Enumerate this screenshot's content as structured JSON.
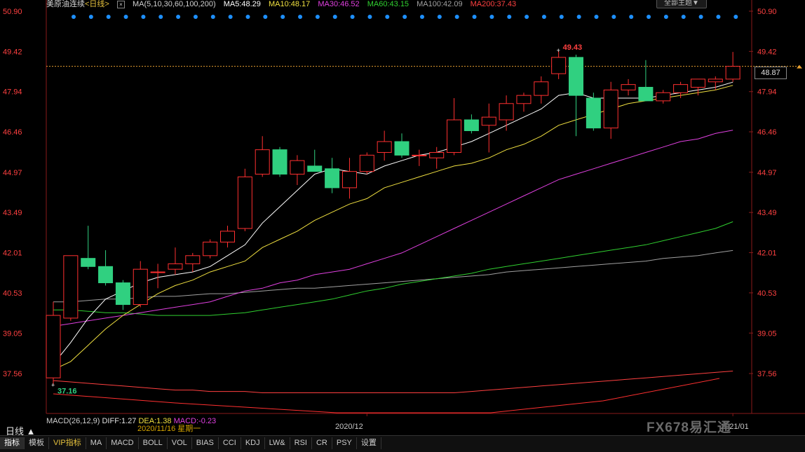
{
  "header": {
    "symbol": "美原油连续",
    "period": "<日线>",
    "ma_title": "MA(5,10,30,60,100,200)",
    "ma_values": [
      {
        "label": "MA5:48.29",
        "color": "#ffffff"
      },
      {
        "label": "MA10:48.17",
        "color": "#f0e040"
      },
      {
        "label": "MA30:46.52",
        "color": "#e040e0"
      },
      {
        "label": "MA60:43.15",
        "color": "#30d030"
      },
      {
        "label": "MA100:42.09",
        "color": "#a0a0a0"
      },
      {
        "label": "MA200:37.43",
        "color": "#ff4040"
      }
    ],
    "theme_button": "全部主题▼"
  },
  "last_price": "48.87",
  "price_axis_labels": [
    "50.90",
    "49.42",
    "47.94",
    "46.46",
    "44.97",
    "43.49",
    "42.01",
    "40.53",
    "39.05",
    "37.56"
  ],
  "high_label": "49.43",
  "low_label": "37.16",
  "bottom": {
    "period_label": "日线 ▲",
    "macd_title": "MACD(26,12,9)",
    "diff": "DIFF:1.27",
    "dea": "DEA:1.38",
    "macd": "MACD:-0.23",
    "cursor_date": "2020/11/16 星期一",
    "date_ticks": [
      {
        "label": "2020/12",
        "idx": 18
      },
      {
        "label": "2021/01",
        "idx": 39
      }
    ],
    "watermark": "FX678易汇通"
  },
  "toolbar": {
    "tabs": [
      "指标",
      "模板",
      "VIP指标",
      "MA",
      "MACD",
      "BOLL",
      "VOL",
      "BIAS",
      "CCI",
      "KDJ",
      "LW&",
      "RSI",
      "CR",
      "PSY",
      "设置"
    ]
  },
  "colors": {
    "up": "#ff3030",
    "down": "#30d080",
    "ma5": "#ffffff",
    "ma10": "#f0e040",
    "ma30": "#e040e0",
    "ma60": "#30d030",
    "ma100": "#a0a0a0",
    "ma200": "#ff4040"
  },
  "chart_data": {
    "type": "candlestick",
    "ylim": [
      37.0,
      51.0
    ],
    "candles": [
      {
        "o": 37.4,
        "h": 40.2,
        "l": 37.16,
        "c": 39.7
      },
      {
        "o": 39.6,
        "h": 40.0,
        "l": 39.5,
        "c": 41.9
      },
      {
        "o": 41.8,
        "h": 43.0,
        "l": 41.4,
        "c": 41.5
      },
      {
        "o": 41.5,
        "h": 42.1,
        "l": 40.8,
        "c": 40.9
      },
      {
        "o": 40.9,
        "h": 41.0,
        "l": 39.9,
        "c": 40.1
      },
      {
        "o": 40.1,
        "h": 41.7,
        "l": 40.0,
        "c": 41.4
      },
      {
        "o": 41.3,
        "h": 41.6,
        "l": 40.7,
        "c": 41.3
      },
      {
        "o": 41.4,
        "h": 42.2,
        "l": 41.2,
        "c": 41.6
      },
      {
        "o": 41.6,
        "h": 42.0,
        "l": 41.3,
        "c": 41.9
      },
      {
        "o": 41.9,
        "h": 42.5,
        "l": 41.8,
        "c": 42.4
      },
      {
        "o": 42.4,
        "h": 43.0,
        "l": 42.2,
        "c": 42.8
      },
      {
        "o": 42.9,
        "h": 45.1,
        "l": 42.8,
        "c": 44.8
      },
      {
        "o": 44.9,
        "h": 46.3,
        "l": 44.8,
        "c": 45.8
      },
      {
        "o": 45.8,
        "h": 45.9,
        "l": 44.8,
        "c": 44.9
      },
      {
        "o": 44.9,
        "h": 45.6,
        "l": 44.5,
        "c": 45.4
      },
      {
        "o": 45.2,
        "h": 45.8,
        "l": 45.0,
        "c": 45.0
      },
      {
        "o": 45.1,
        "h": 45.5,
        "l": 44.2,
        "c": 44.4
      },
      {
        "o": 44.4,
        "h": 45.5,
        "l": 44.0,
        "c": 45.0
      },
      {
        "o": 45.0,
        "h": 45.7,
        "l": 44.9,
        "c": 45.6
      },
      {
        "o": 45.7,
        "h": 46.5,
        "l": 45.4,
        "c": 46.1
      },
      {
        "o": 46.1,
        "h": 46.4,
        "l": 45.5,
        "c": 45.6
      },
      {
        "o": 45.6,
        "h": 45.8,
        "l": 45.2,
        "c": 45.6
      },
      {
        "o": 45.5,
        "h": 45.9,
        "l": 45.1,
        "c": 45.7
      },
      {
        "o": 45.7,
        "h": 47.7,
        "l": 45.6,
        "c": 46.9
      },
      {
        "o": 46.9,
        "h": 47.1,
        "l": 46.4,
        "c": 46.5
      },
      {
        "o": 46.7,
        "h": 47.5,
        "l": 45.7,
        "c": 47.0
      },
      {
        "o": 46.9,
        "h": 47.8,
        "l": 46.5,
        "c": 47.5
      },
      {
        "o": 47.5,
        "h": 47.9,
        "l": 47.2,
        "c": 47.8
      },
      {
        "o": 47.8,
        "h": 48.5,
        "l": 47.5,
        "c": 48.3
      },
      {
        "o": 48.6,
        "h": 49.43,
        "l": 48.4,
        "c": 49.2
      },
      {
        "o": 49.2,
        "h": 49.3,
        "l": 46.3,
        "c": 47.8
      },
      {
        "o": 47.7,
        "h": 47.9,
        "l": 46.5,
        "c": 46.6
      },
      {
        "o": 46.6,
        "h": 48.3,
        "l": 46.2,
        "c": 48.0
      },
      {
        "o": 48.0,
        "h": 48.4,
        "l": 47.8,
        "c": 48.2
      },
      {
        "o": 48.1,
        "h": 49.1,
        "l": 47.6,
        "c": 47.6
      },
      {
        "o": 47.6,
        "h": 48.0,
        "l": 47.5,
        "c": 47.9
      },
      {
        "o": 47.9,
        "h": 48.3,
        "l": 47.7,
        "c": 48.2
      },
      {
        "o": 48.1,
        "h": 48.4,
        "l": 47.8,
        "c": 48.4
      },
      {
        "o": 48.3,
        "h": 48.5,
        "l": 48.0,
        "c": 48.4
      },
      {
        "o": 48.4,
        "h": 49.4,
        "l": 48.3,
        "c": 48.87
      }
    ],
    "ma5": [
      37.9,
      38.7,
      39.6,
      40.3,
      40.6,
      40.9,
      41.1,
      41.2,
      41.3,
      41.5,
      41.9,
      42.3,
      43.1,
      43.7,
      44.3,
      44.9,
      45.1,
      45.0,
      44.9,
      45.2,
      45.4,
      45.6,
      45.7,
      45.9,
      46.1,
      46.4,
      46.7,
      47.0,
      47.3,
      47.8,
      47.9,
      47.7,
      47.7,
      47.7,
      47.7,
      47.8,
      47.9,
      48.0,
      48.1,
      48.29
    ],
    "ma10": [
      37.7,
      38.0,
      38.6,
      39.2,
      39.7,
      40.1,
      40.5,
      40.8,
      41.0,
      41.3,
      41.5,
      41.7,
      42.2,
      42.5,
      42.8,
      43.2,
      43.5,
      43.8,
      44.0,
      44.4,
      44.6,
      44.8,
      45.0,
      45.2,
      45.3,
      45.5,
      45.8,
      46.0,
      46.3,
      46.7,
      46.9,
      47.1,
      47.3,
      47.5,
      47.6,
      47.7,
      47.8,
      47.9,
      48.0,
      48.17
    ],
    "ma30": [
      39.3,
      39.4,
      39.5,
      39.6,
      39.7,
      39.8,
      39.9,
      40.0,
      40.1,
      40.2,
      40.4,
      40.6,
      40.7,
      40.9,
      41.0,
      41.2,
      41.3,
      41.4,
      41.6,
      41.8,
      42.0,
      42.3,
      42.6,
      42.9,
      43.2,
      43.5,
      43.8,
      44.1,
      44.4,
      44.7,
      44.9,
      45.1,
      45.3,
      45.5,
      45.7,
      45.9,
      46.1,
      46.2,
      46.4,
      46.52
    ],
    "ma60": [
      39.9,
      39.9,
      39.85,
      39.8,
      39.8,
      39.75,
      39.7,
      39.7,
      39.7,
      39.7,
      39.75,
      39.8,
      39.9,
      40.0,
      40.1,
      40.2,
      40.3,
      40.45,
      40.6,
      40.7,
      40.85,
      40.95,
      41.05,
      41.15,
      41.25,
      41.4,
      41.5,
      41.6,
      41.7,
      41.8,
      41.9,
      42.0,
      42.1,
      42.2,
      42.3,
      42.45,
      42.6,
      42.75,
      42.9,
      43.15
    ],
    "ma100": [
      40.2,
      40.2,
      40.25,
      40.3,
      40.3,
      40.35,
      40.4,
      40.4,
      40.45,
      40.5,
      40.5,
      40.55,
      40.6,
      40.65,
      40.7,
      40.7,
      40.75,
      40.8,
      40.85,
      40.9,
      40.95,
      41.0,
      41.05,
      41.1,
      41.15,
      41.2,
      41.3,
      41.35,
      41.4,
      41.45,
      41.5,
      41.55,
      41.6,
      41.65,
      41.7,
      41.8,
      41.85,
      41.9,
      42.0,
      42.09
    ],
    "ma200": [
      37.3,
      37.25,
      37.2,
      37.15,
      37.1,
      37.05,
      37.0,
      36.95,
      36.95,
      36.9,
      36.9,
      36.9,
      36.85,
      36.85,
      36.85,
      36.85,
      36.85,
      36.85,
      36.85,
      36.85,
      36.85,
      36.85,
      36.85,
      36.85,
      36.9,
      36.95,
      37.0,
      37.05,
      37.1,
      37.15,
      37.2,
      37.25,
      37.3,
      37.35,
      37.4,
      37.45,
      37.5,
      37.55,
      37.6,
      37.65
    ],
    "signal_dots_count": 39
  }
}
